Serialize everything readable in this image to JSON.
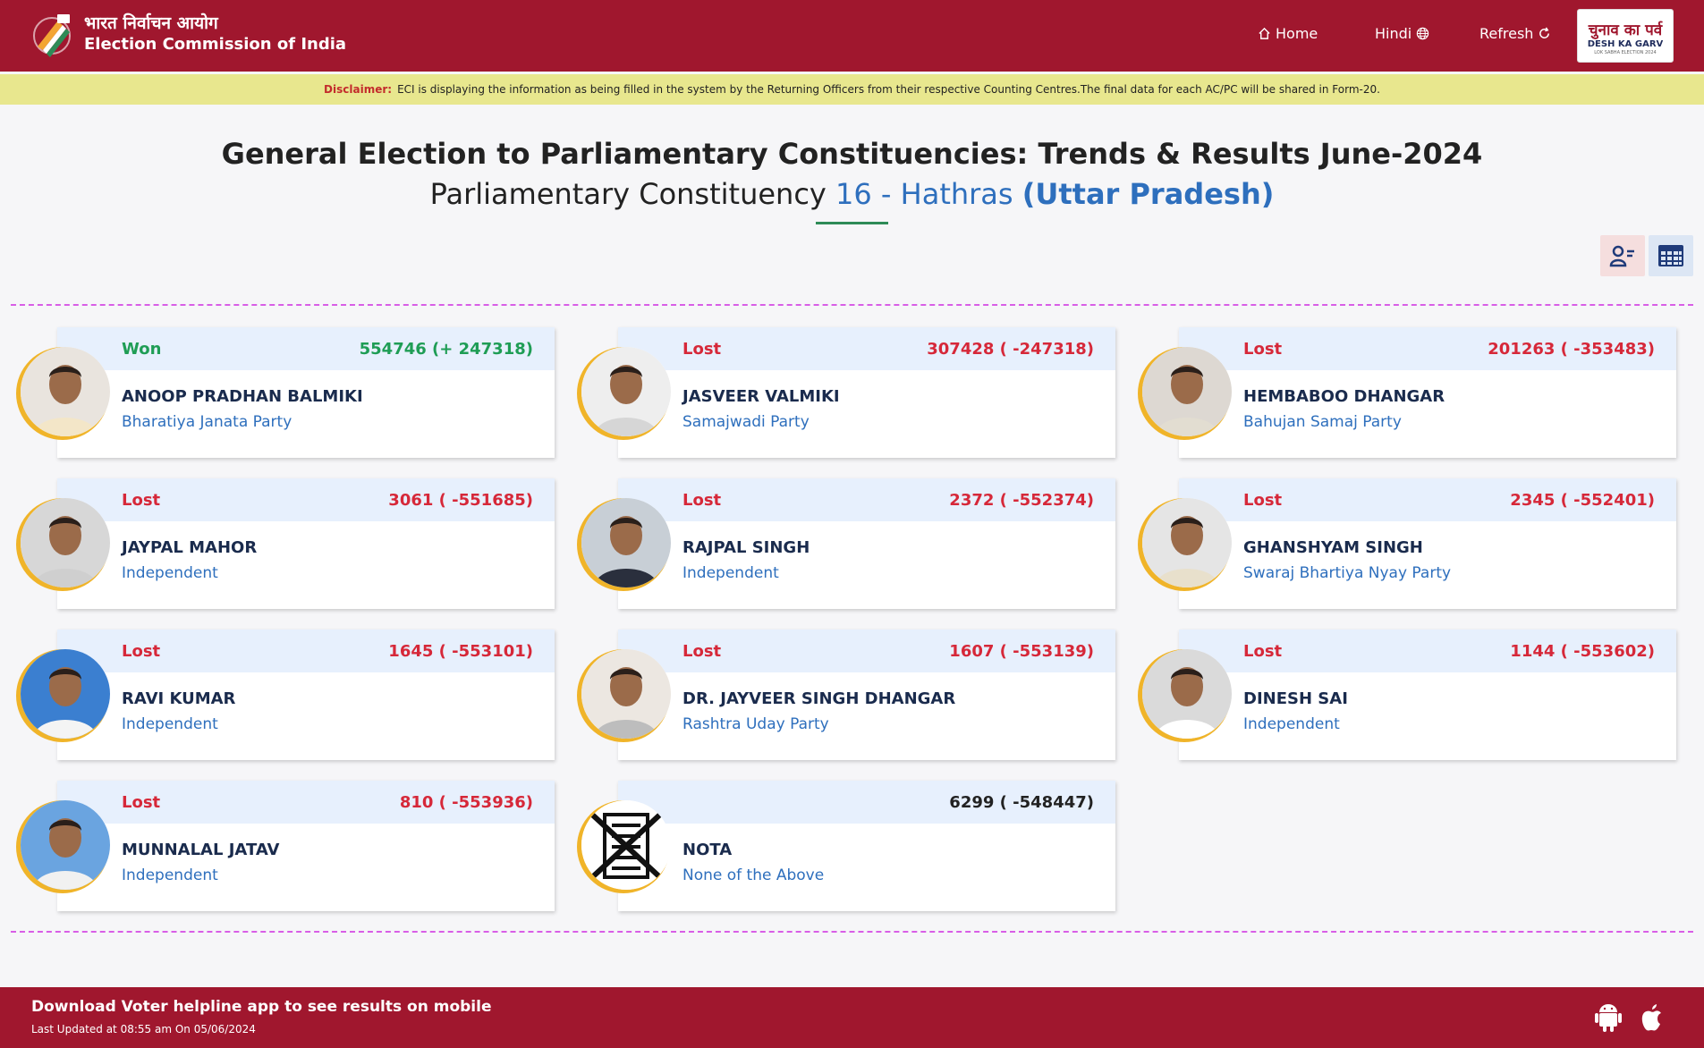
{
  "header": {
    "brand_hindi": "भारत निर्वाचन आयोग",
    "brand_english": "Election Commission of India",
    "nav_home": "Home",
    "nav_hindi": "Hindi",
    "nav_refresh": "Refresh",
    "badge_hindi": "चुनाव का पर्व",
    "badge_english": "DESH KA GARV",
    "badge_small": "LOK SABHA ELECTION 2024",
    "primary_color": "#a0172e"
  },
  "disclaimer": {
    "label": "Disclaimer:",
    "text": "ECI is displaying the information as being filled in the system by the Returning Officers from their respective Counting Centres.The final data for each AC/PC will be shared in Form-20."
  },
  "page": {
    "title": "General Election to Parliamentary Constituencies: Trends & Results June-2024",
    "subtitle_prefix": "Parliamentary Constituency",
    "constituency": "16 - Hathras",
    "state": "(Uttar Pradesh)"
  },
  "candidates": [
    {
      "status": "Won",
      "votes": "554746 (+ 247318)",
      "name": "ANOOP PRADHAN BALMIKI",
      "party": "Bharatiya Janata Party"
    },
    {
      "status": "Lost",
      "votes": "307428 ( -247318)",
      "name": "JASVEER VALMIKI",
      "party": "Samajwadi Party"
    },
    {
      "status": "Lost",
      "votes": "201263 ( -353483)",
      "name": "HEMBABOO DHANGAR",
      "party": "Bahujan Samaj Party"
    },
    {
      "status": "Lost",
      "votes": "3061 ( -551685)",
      "name": "JAYPAL MAHOR",
      "party": "Independent"
    },
    {
      "status": "Lost",
      "votes": "2372 ( -552374)",
      "name": "RAJPAL SINGH",
      "party": "Independent"
    },
    {
      "status": "Lost",
      "votes": "2345 ( -552401)",
      "name": "GHANSHYAM SINGH",
      "party": "Swaraj Bhartiya Nyay Party"
    },
    {
      "status": "Lost",
      "votes": "1645 ( -553101)",
      "name": "RAVI KUMAR",
      "party": "Independent"
    },
    {
      "status": "Lost",
      "votes": "1607 ( -553139)",
      "name": "DR. JAYVEER SINGH DHANGAR",
      "party": "Rashtra Uday Party"
    },
    {
      "status": "Lost",
      "votes": "1144 ( -553602)",
      "name": "DINESH SAI",
      "party": "Independent"
    },
    {
      "status": "Lost",
      "votes": "810 ( -553936)",
      "name": "MUNNALAL JATAV",
      "party": "Independent"
    },
    {
      "status": "",
      "votes": "6299 ( -548447)",
      "name": "NOTA",
      "party": "None of the Above"
    }
  ],
  "footer": {
    "line1": "Download Voter helpline app to see results on mobile",
    "line2": "Last Updated at 08:55 am On 05/06/2024"
  }
}
